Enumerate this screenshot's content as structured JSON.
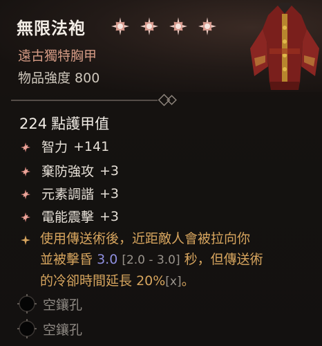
{
  "item": {
    "name": "無限法袍",
    "star_count": 4,
    "type": "遠古獨特胸甲",
    "power_label": "物品強度",
    "power_value": "800",
    "armor_value": "224",
    "armor_label": "點護甲值"
  },
  "affixes": [
    {
      "name": "智力",
      "value": "+141"
    },
    {
      "name": "棄防強攻",
      "value": "+3"
    },
    {
      "name": "元素調諧",
      "value": "+3"
    },
    {
      "name": "電能震擊",
      "value": "+3"
    }
  ],
  "unique_power": {
    "line1": "使用傳送術後，近距敵人會被拉向你",
    "line2_pre": "並被擊昏",
    "line2_val": "3.0",
    "line2_range": "[2.0 - 3.0]",
    "line2_post": "秒，但傳送術",
    "line3_pre": "的冷卻時間延長",
    "line3_val": "20%",
    "line3_range": "[x]",
    "line3_post": "。"
  },
  "sockets": [
    {
      "label": "空鑲孔"
    },
    {
      "label": "空鑲孔"
    }
  ],
  "colors": {
    "unique_text": "#d7a55e",
    "value_blue": "#8f8fe0",
    "item_type": "#d49a84",
    "affix_bullet": "#d4857c"
  },
  "icons": [
    "star-icon",
    "affix-bullet-icon",
    "unique-bullet-icon",
    "socket-icon",
    "chest-armor-portrait"
  ]
}
